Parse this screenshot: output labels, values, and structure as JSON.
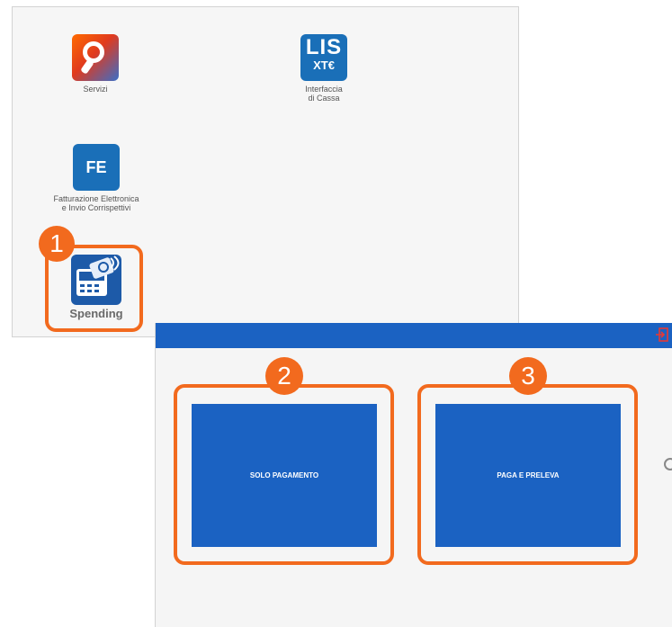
{
  "launcher": {
    "apps": [
      {
        "name": "Servizi"
      },
      {
        "name": "Interfaccia\ndi Cassa",
        "icon_text_top": "LIS",
        "icon_text_bottom": "XT€"
      },
      {
        "name": "Fatturazione Elettronica\ne Invio Corrispettivi",
        "icon_text": "FE"
      },
      {
        "name": "Spending"
      }
    ]
  },
  "callouts": [
    "1",
    "2",
    "3"
  ],
  "spending_screen": {
    "buttons": [
      "SOLO PAGAMENTO",
      "PAGA E PRELEVA"
    ]
  },
  "colors": {
    "accent_orange": "#f26a1e",
    "primary_blue": "#1b62c2"
  },
  "icons": {
    "servizi": "servizi-app-icon",
    "lis": "lis-app-icon",
    "fe": "fe-app-icon",
    "spending": "spending-app-icon",
    "exit": "exit-icon"
  }
}
